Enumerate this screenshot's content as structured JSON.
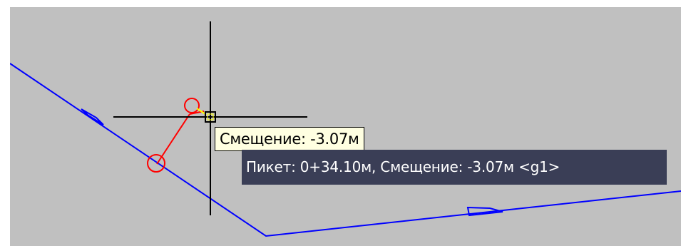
{
  "tooltip": {
    "offset_text": "Смещение: -3.07м"
  },
  "status": {
    "station_text": "Пикет: 0+34.10м, Смещение: -3.07м <g1>"
  },
  "colors": {
    "background": "#c0c0c0",
    "alignment_line": "#0000ff",
    "offset_line": "#ff0000",
    "crosshair": "#000000",
    "tooltip_bg": "#ffffe1",
    "status_bg": "#3a3e56"
  }
}
